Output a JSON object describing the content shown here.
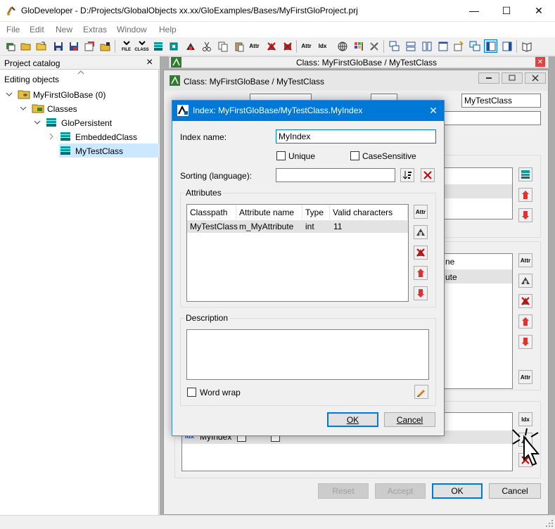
{
  "window": {
    "title": "GloDeveloper - D:/Projects/GlobalObjects xx.xx/GloExamples/Bases/MyFirstGloProject.prj",
    "minimize_glyph": "—",
    "maximize_glyph": "☐",
    "close_glyph": "✕"
  },
  "menu": {
    "items": [
      {
        "label": "File"
      },
      {
        "label": "Edit"
      },
      {
        "label": "New"
      },
      {
        "label": "Extras"
      },
      {
        "label": "Window"
      },
      {
        "label": "Help"
      }
    ]
  },
  "toolbar": {
    "file_label": "FILE",
    "class_label": "CLASS",
    "attr_label": "Attr",
    "idx_label": "Idx"
  },
  "catalog": {
    "title": "Project catalog",
    "close_glyph": "×",
    "section": "Editing objects",
    "tree": {
      "base": "MyFirstGloBase (0)",
      "classes": "Classes",
      "persistent": "GloPersistent",
      "embedded": "EmbeddedClass",
      "selected": "MyTestClass"
    }
  },
  "mdi": {
    "strip_title": "Class: MyFirstGloBase / MyTestClass",
    "close_glyph": "✕"
  },
  "class_window": {
    "title": "Class: MyFirstGloBase / MyTestClass",
    "table_value": "MyTestClass",
    "right_list_1": "ne",
    "right_list_2": "ute",
    "index_row_label": "MyIndex",
    "index_badge": "idx",
    "buttons": {
      "reset": "Reset",
      "accept": "Accept",
      "ok": "OK",
      "cancel": "Cancel"
    },
    "colors": {
      "disabled_text": "#a0a0a0"
    }
  },
  "index_dialog": {
    "title": "Index: MyFirstGloBase/MyTestClass.MyIndex",
    "close_glyph": "✕",
    "index_name_label": "Index name:",
    "index_name_value": "MyIndex",
    "unique_label": "Unique",
    "case_sensitive_label": "CaseSensitive",
    "sorting_label": "Sorting (language):",
    "sorting_value": "",
    "attributes_group": "Attributes",
    "columns": [
      "Classpath",
      "Attribute name",
      "Type",
      "Valid characters"
    ],
    "rows": [
      {
        "classpath": "MyTestClass",
        "attribute_name": "m_MyAttribute",
        "type": "int",
        "valid_characters": "11"
      }
    ],
    "description_group": "Description",
    "description_value": "",
    "word_wrap_label": "Word wrap",
    "ok_label": "OK",
    "cancel_label": "Cancel",
    "accent_color": "#0078d7"
  }
}
